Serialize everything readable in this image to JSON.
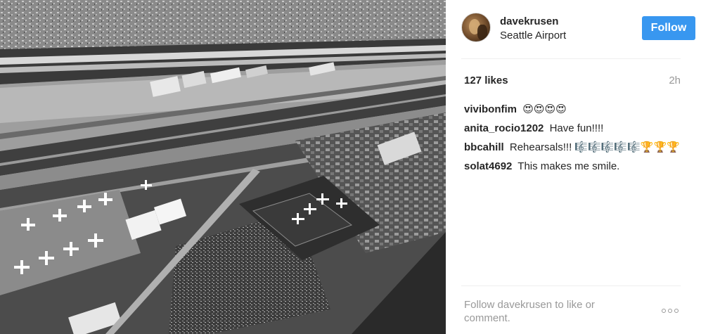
{
  "photo": {
    "alt": "Aerial black and white view of Seattle Airport"
  },
  "header": {
    "username": "davekrusen",
    "location": "Seattle Airport",
    "follow_label": "Follow",
    "follow_color": "#3897f0"
  },
  "stats": {
    "likes": "127 likes",
    "time": "2h"
  },
  "comments": [
    {
      "user": "vivibonfim",
      "text": "😍😍😍😍"
    },
    {
      "user": "anita_rocio1202",
      "text": "Have fun!!!!"
    },
    {
      "user": "bbcahill",
      "text": "Rehearsals!!! 🎼🎼🎼🎼🎼🏆🏆🏆"
    },
    {
      "user": "solat4692",
      "text": "This makes me smile."
    }
  ],
  "footer": {
    "prompt": "Follow davekrusen to like or comment.",
    "more_icon": "more-options-icon"
  }
}
